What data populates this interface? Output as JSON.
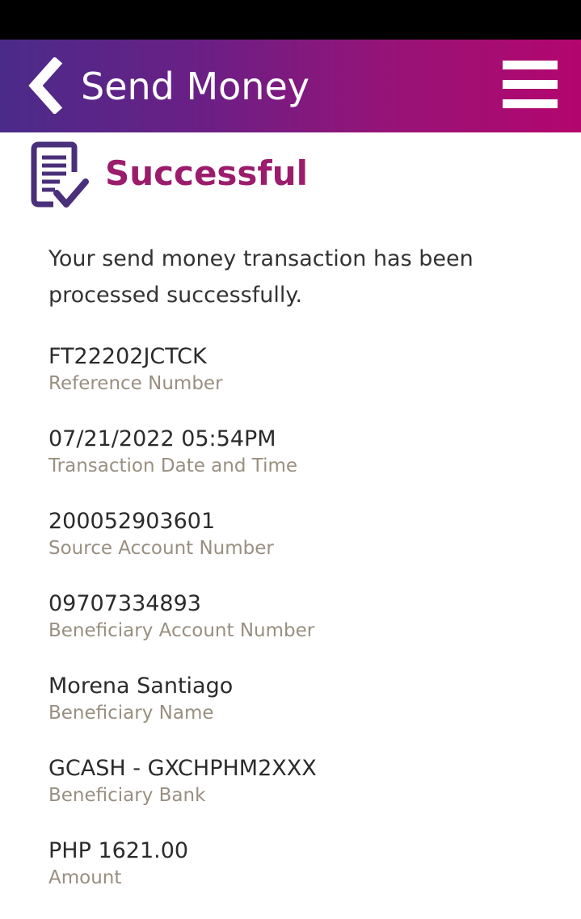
{
  "header": {
    "title": "Send Money",
    "back_icon": "chevron-left-icon",
    "menu_icon": "hamburger-menu-icon",
    "gradient_start": "#4a2b8a",
    "gradient_end": "#b3066e"
  },
  "status": {
    "icon": "document-check-icon",
    "title": "Successful",
    "title_color": "#9b1c6c"
  },
  "message": "Your send money transaction has been processed successfully.",
  "details": [
    {
      "value": "FT22202JCTCK",
      "label": "Reference Number"
    },
    {
      "value": "07/21/2022 05:54PM",
      "label": "Transaction Date and Time"
    },
    {
      "value": "200052903601",
      "label": "Source Account Number"
    },
    {
      "value": "09707334893",
      "label": "Beneficiary Account Number"
    },
    {
      "value": "Morena Santiago",
      "label": "Beneficiary Name"
    },
    {
      "value": "GCASH - GXCHPHM2XXX",
      "label": "Beneficiary Bank"
    },
    {
      "value": "PHP 1621.00",
      "label": "Amount"
    }
  ]
}
